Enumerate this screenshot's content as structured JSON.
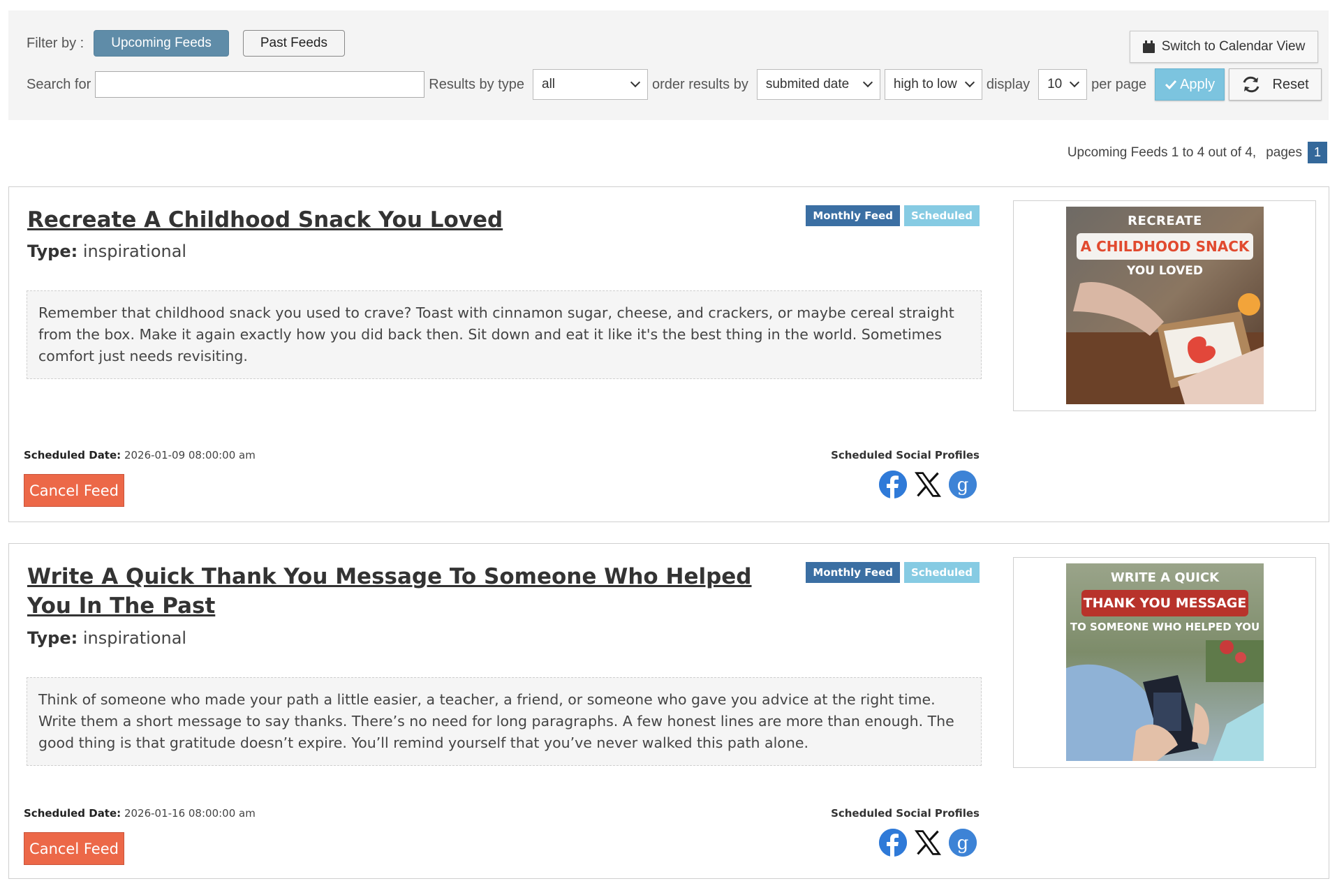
{
  "filter": {
    "filter_by_label": "Filter by :",
    "tabs": [
      {
        "label": "Upcoming Feeds",
        "active": true
      },
      {
        "label": "Past Feeds",
        "active": false
      }
    ],
    "calendar_button": "Switch to Calendar View",
    "search_label": "Search for",
    "search_value": "",
    "results_by_type_label": "Results by type",
    "type_value": "all",
    "order_label": "order results by",
    "order_value": "submited date",
    "direction_value": "high to low",
    "display_label": "display",
    "per_page_value": "10",
    "per_page_label": "per page",
    "apply_label": "Apply",
    "reset_label": "Reset"
  },
  "pager": {
    "summary": "Upcoming Feeds 1 to 4 out of 4,",
    "pages_label": "pages",
    "current_page": "1"
  },
  "feeds": [
    {
      "title": "Recreate A Childhood Snack You Loved",
      "type_label": "Type:",
      "type_value": "inspirational",
      "badges": [
        "Monthly Feed",
        "Scheduled"
      ],
      "description": "Remember that childhood snack you used to crave? Toast with cinnamon sugar, cheese, and crackers, or maybe cereal straight from the box. Make it again exactly how you did back then. Sit down and eat it like it's the best thing in the world. Sometimes comfort just needs revisiting.",
      "scheduled_label": "Scheduled Date:",
      "scheduled_date": "2026-01-09 08:00:00 am",
      "cancel_label": "Cancel Feed",
      "profiles_label": "Scheduled Social Profiles",
      "profiles": [
        "facebook-icon",
        "x-icon",
        "google-icon"
      ],
      "image_text": {
        "line1": "RECREATE",
        "line2": "A CHILDHOOD SNACK",
        "line3": "YOU LOVED"
      }
    },
    {
      "title": "Write A Quick Thank You Message To Someone Who Helped You In The Past",
      "type_label": "Type:",
      "type_value": "inspirational",
      "badges": [
        "Monthly Feed",
        "Scheduled"
      ],
      "description": "Think of someone who made your path a little easier, a teacher, a friend, or someone who gave you advice at the right time. Write them a short message to say thanks. There’s no need for long paragraphs. A few honest lines are more than enough. The good thing is that gratitude doesn’t expire. You’ll remind yourself that you’ve never walked this path alone.",
      "scheduled_label": "Scheduled Date:",
      "scheduled_date": "2026-01-16 08:00:00 am",
      "cancel_label": "Cancel Feed",
      "profiles_label": "Scheduled Social Profiles",
      "profiles": [
        "facebook-icon",
        "x-icon",
        "google-icon"
      ],
      "image_text": {
        "line1": "WRITE A QUICK",
        "line2": "THANK YOU MESSAGE",
        "line3": "TO SOMEONE WHO HELPED YOU"
      }
    }
  ],
  "colors": {
    "tab_active": "#5f8ca8",
    "apply": "#7cc4df",
    "cancel": "#ec6848",
    "badge_monthly": "#3b6fa3",
    "badge_scheduled": "#86cbe3",
    "facebook": "#2f7ad8",
    "google": "#3d83d6"
  }
}
